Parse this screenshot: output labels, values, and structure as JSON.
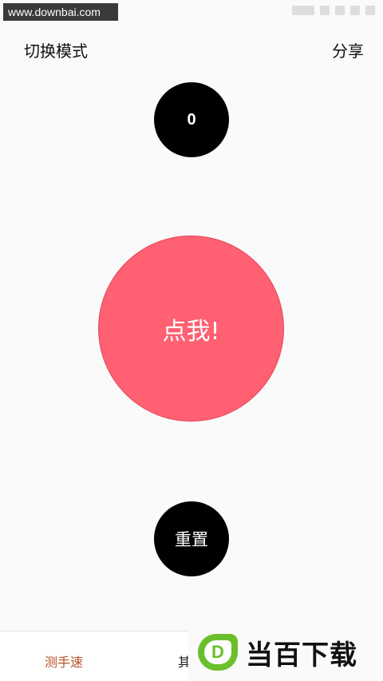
{
  "watermark": {
    "url": "www.downbai.com",
    "logo_text": "当百下载",
    "logo_letter": "D"
  },
  "top_bar": {
    "left_label": "切换模式",
    "right_label": "分享"
  },
  "counter": {
    "value": "0"
  },
  "tap_button": {
    "label": "点我!"
  },
  "reset_button": {
    "label": "重置"
  },
  "bottom_nav": {
    "tab1": "测手速",
    "tab2": "其"
  },
  "colors": {
    "tap_button": "#ff6072",
    "active_tab": "#b8532a",
    "logo_green": "#6abf2a"
  }
}
